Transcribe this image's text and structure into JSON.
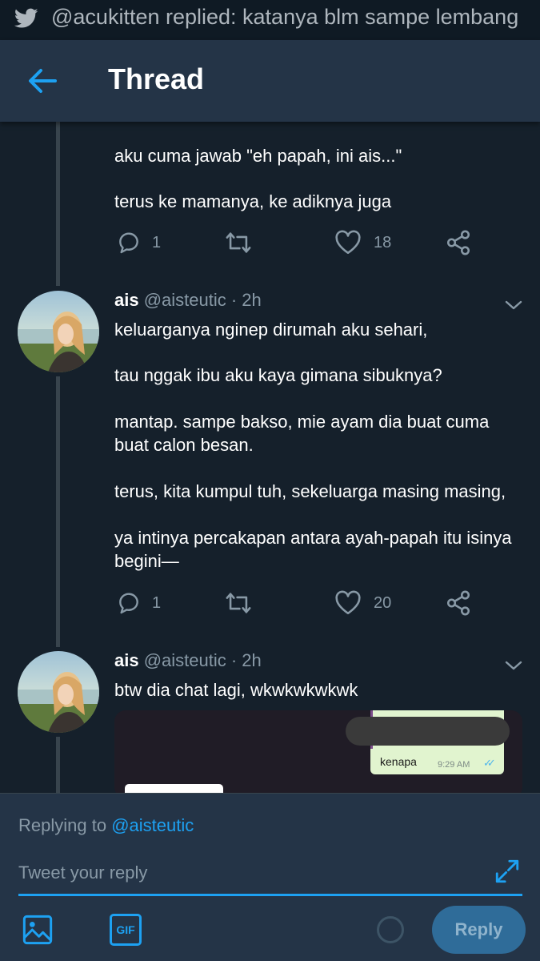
{
  "status_bar": {
    "notification": "@acukitten replied: katanya blm sampe lembang",
    "app_icon": "twitter-bird-icon"
  },
  "header": {
    "title": "Thread",
    "back_icon": "back-arrow-icon"
  },
  "tweets": [
    {
      "text_lines": [
        "aku cuma jawab \"eh papah, ini ais...\"",
        "terus ke mamanya, ke adiknya juga"
      ],
      "replies": "1",
      "likes": "18"
    },
    {
      "name": "ais",
      "handle": "@aisteutic · 2h",
      "text_lines": [
        "keluarganya nginep dirumah aku sehari,",
        "tau nggak ibu aku kaya gimana sibuknya?",
        "mantap. sampe bakso, mie ayam dia buat cuma",
        "buat calon besan.",
        "terus, kita kumpul tuh, sekeluarga masing masing,",
        "ya intinya percakapan antara ayah-papah itu isinya",
        "begini—"
      ],
      "replies": "1",
      "likes": "20"
    },
    {
      "name": "ais",
      "handle": "@aisteutic · 2h",
      "text_lines": [
        "btw dia chat lagi, wkwkwkwkwk"
      ],
      "media": {
        "message": "kenapa",
        "time": "9:29 AM",
        "ticks": "✓✓"
      }
    }
  ],
  "composer": {
    "replying_label": "Replying to",
    "replying_handle": "@aisteutic",
    "placeholder": "Tweet your reply",
    "gif_label": "GIF",
    "reply_button": "Reply"
  },
  "colors": {
    "background": "#15202b",
    "header": "#243447",
    "accent": "#1da1f2",
    "muted": "#8899a6"
  }
}
